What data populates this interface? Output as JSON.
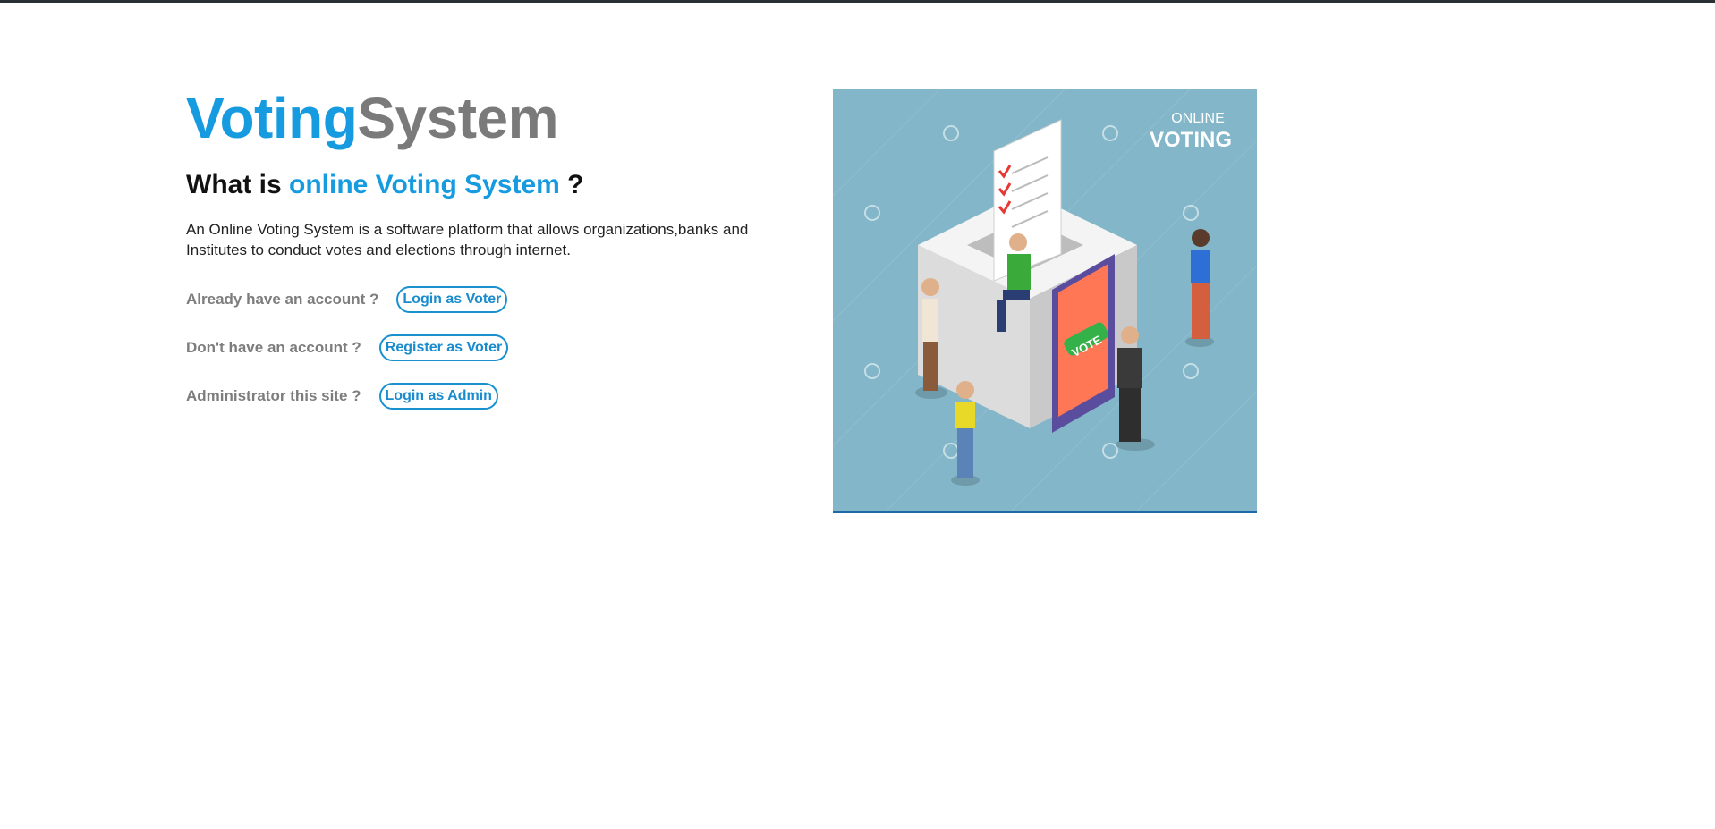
{
  "brand": {
    "part1": "Voting",
    "part2": "System"
  },
  "headline": {
    "prefix": "What is ",
    "highlight": "online Voting System",
    "suffix": " ?"
  },
  "description": "An Online Voting System is a software platform that allows organizations,banks and Institutes to conduct votes and elections through internet.",
  "actions": [
    {
      "label": "Already have an account ?",
      "button": "Login as Voter"
    },
    {
      "label": "Don't have an account ?",
      "button": "Register as Voter"
    },
    {
      "label": "Administrator this site ?",
      "button": "Login as Admin"
    }
  ],
  "illustration": {
    "line1": "ONLINE",
    "line2": "VOTING",
    "vote_button": "VOTE"
  },
  "colors": {
    "accent": "#169be0",
    "muted": "#7a7a7a",
    "illustration_bg": "#82b6c8"
  }
}
